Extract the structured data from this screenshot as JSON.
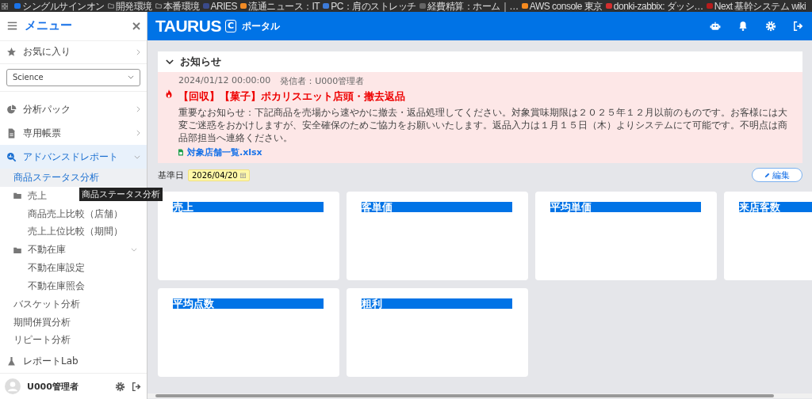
{
  "bookmarks": [
    {
      "label": "シングルサインオン"
    },
    {
      "label": "開発環境"
    },
    {
      "label": "本番環境"
    },
    {
      "label": "ARIES"
    },
    {
      "label": "流通ニュース：IT"
    },
    {
      "label": "PC：肩のストレッチ"
    },
    {
      "label": "経費精算：ホーム｜…"
    },
    {
      "label": "AWS console 東京"
    },
    {
      "label": "donki-zabbix: ダッシ…"
    },
    {
      "label": "Next 基幹システム wiki"
    }
  ],
  "sidebar": {
    "title": "メニュー",
    "favorites": "お気に入り",
    "select": {
      "value": "Science"
    },
    "items": [
      {
        "label": "分析パック",
        "kind": "menu",
        "expanded": false
      },
      {
        "label": "専用帳票",
        "kind": "menu",
        "expanded": false
      },
      {
        "label": "アドバンスドレポート",
        "kind": "menu",
        "expanded": true,
        "children": [
          {
            "label": "商品ステータス分析",
            "kind": "link",
            "selected": true
          },
          {
            "label": "売上",
            "kind": "folder",
            "expanded": true,
            "children": [
              {
                "label": "商品売上比較（店舗）",
                "selected": false
              },
              {
                "label": "売上上位比較（期間）",
                "selected": false
              }
            ]
          },
          {
            "label": "不動在庫",
            "kind": "folder",
            "expanded": true,
            "children": [
              {
                "label": "不動在庫設定",
                "selected": false
              },
              {
                "label": "不動在庫照会",
                "selected": false
              }
            ]
          },
          {
            "label": "バスケット分析",
            "kind": "link",
            "selected": false
          },
          {
            "label": "期間併買分析",
            "kind": "link",
            "selected": false
          },
          {
            "label": "リピート分析",
            "kind": "link",
            "selected": false
          }
        ]
      },
      {
        "label": "レポートLab",
        "kind": "leaf",
        "expanded": false
      }
    ],
    "user": "U000管理者"
  },
  "tooltip": "商品ステータス分析",
  "header": {
    "logo": "TAURUS",
    "logo_badge": "C",
    "subtitle": "ポータル"
  },
  "notice": {
    "title": "お知らせ",
    "expanded": true,
    "date": "2024/01/12 00:00:00",
    "sender": "発信者：U000管理者",
    "headline": "【回収】【菓子】ポカリスエット店頭・撤去返品",
    "body": "重要なお知らせ：下記商品を売場から速やかに撤去・返品処理してください。対象賞味期限は２０２５年１２月以前のものです。お客様には大変ご迷惑をおかけしますが、安全確保のためご協力をお願いいたします。返品入力は１月１５日（木）よりシステムにて可能です。不明点は商品部担当へ連絡ください。",
    "attachment": "対象店舗一覧.xlsx"
  },
  "base_date": {
    "label": "基準日",
    "value": "2026/04/20"
  },
  "edit_button": "編集",
  "cards": [
    {
      "title": "売上"
    },
    {
      "title": "客単価"
    },
    {
      "title": "平均単価"
    },
    {
      "title": "来店客数"
    },
    {
      "title": "平均点数"
    },
    {
      "title": "粗利"
    }
  ]
}
